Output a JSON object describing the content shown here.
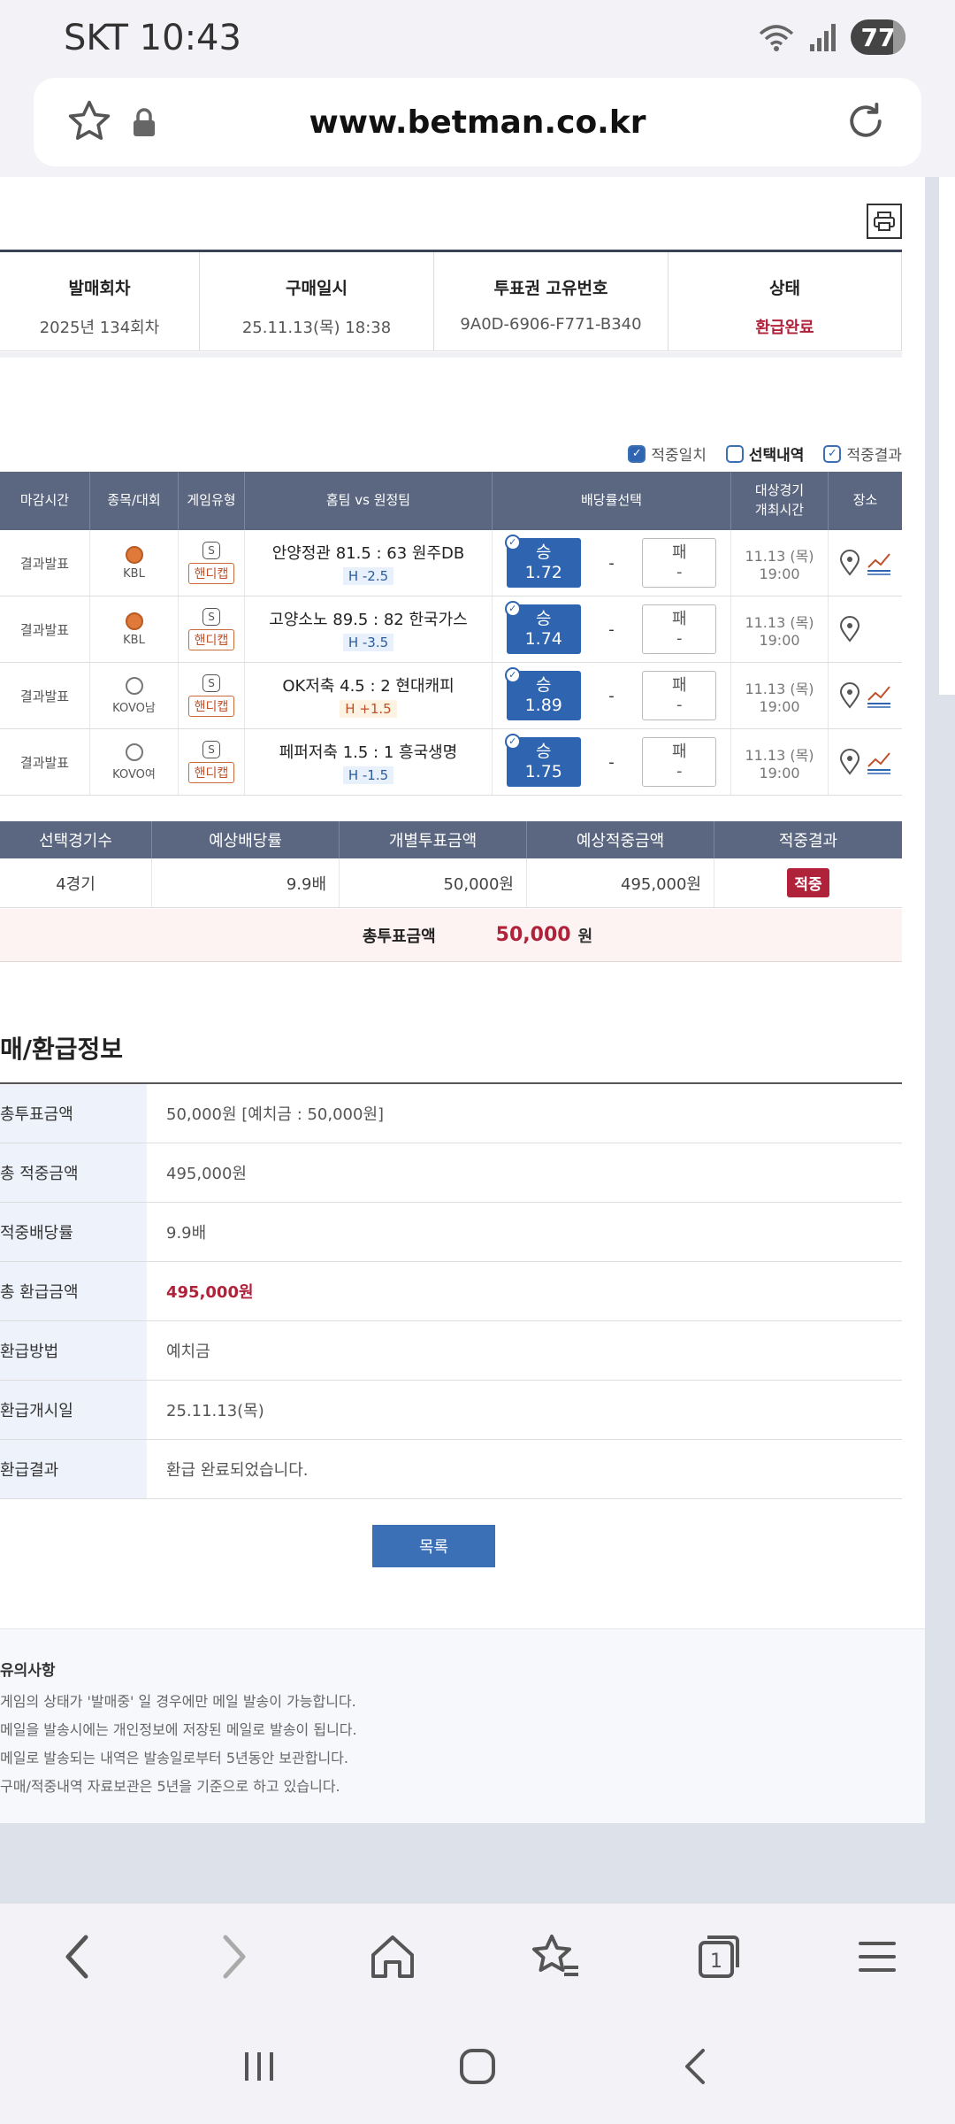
{
  "status": {
    "carrier_time": "SKT 10:43",
    "battery": "77"
  },
  "browser": {
    "url": "www.betman.co.kr"
  },
  "ticket_info": {
    "headers": [
      "발매회차",
      "구매일시",
      "투표권 고유번호",
      "상태"
    ],
    "values": [
      "2025년 134회차",
      "25.11.13(목) 18:38",
      "9A0D-6906-F771-B340",
      "환급완료"
    ]
  },
  "legend": {
    "hit_match": "적중일치",
    "selection": "선택내역",
    "hit_result": "적중결과"
  },
  "game_table": {
    "headers": [
      "마감시간",
      "종목/대회",
      "게임유형",
      "홈팀 vs 원정팀",
      "배당률선택",
      "대상경기\n개최시간",
      "장소"
    ],
    "rows": [
      {
        "close": "결과발표",
        "league": "KBL",
        "sport": "basketball",
        "type": "핸디캡",
        "match": "안양정관 81.5 : 63 원주DB",
        "handicap": "H -2.5",
        "win_label": "승",
        "win_odds": "1.72",
        "draw": "-",
        "lose_label": "패",
        "lose_odds": "-",
        "date": "11.13 (목)",
        "time": "19:00"
      },
      {
        "close": "결과발표",
        "league": "KBL",
        "sport": "basketball",
        "type": "핸디캡",
        "match": "고양소노 89.5 : 82 한국가스",
        "handicap": "H -3.5",
        "win_label": "승",
        "win_odds": "1.74",
        "draw": "-",
        "lose_label": "패",
        "lose_odds": "-",
        "date": "11.13 (목)",
        "time": "19:00"
      },
      {
        "close": "결과발표",
        "league": "KOVO남",
        "sport": "volleyball",
        "type": "핸디캡",
        "match": "OK저축 4.5 : 2 현대캐피",
        "handicap": "H +1.5",
        "win_label": "승",
        "win_odds": "1.89",
        "draw": "-",
        "lose_label": "패",
        "lose_odds": "-",
        "date": "11.13 (목)",
        "time": "19:00"
      },
      {
        "close": "결과발표",
        "league": "KOVO여",
        "sport": "volleyball",
        "type": "핸디캡",
        "match": "페퍼저축 1.5 : 1 흥국생명",
        "handicap": "H -1.5",
        "win_label": "승",
        "win_odds": "1.75",
        "draw": "-",
        "lose_label": "패",
        "lose_odds": "-",
        "date": "11.13 (목)",
        "time": "19:00"
      }
    ],
    "s_icon": "S"
  },
  "summary": {
    "headers": [
      "선택경기수",
      "예상배당률",
      "개별투표금액",
      "예상적중금액",
      "적중결과"
    ],
    "values": [
      "4경기",
      "9.9배",
      "50,000원",
      "495,000원"
    ],
    "result_badge": "적중",
    "total_label": "총투표금액",
    "total_amount": "50,000",
    "total_unit": "원"
  },
  "refund": {
    "title": "매/환급정보",
    "rows": [
      {
        "label": "총투표금액",
        "value": "50,000원 [예치금 : 50,000원]"
      },
      {
        "label": "총 적중금액",
        "value": "495,000원"
      },
      {
        "label": "적중배당률",
        "value": "9.9배"
      },
      {
        "label": "총 환급금액",
        "value": "495,000원"
      },
      {
        "label": "환급방법",
        "value": "예치금"
      },
      {
        "label": "환급개시일",
        "value": "25.11.13(목)"
      },
      {
        "label": "환급결과",
        "value": "환급 완료되었습니다."
      }
    ],
    "list_button": "목록"
  },
  "notice": {
    "title": "유의사항",
    "items": [
      "게임의 상태가 '발매중' 일 경우에만 메일 발송이 가능합니다.",
      "메일을 발송시에는 개인정보에 저장된 메일로 발송이 됩니다.",
      "메일로 발송되는 내역은 발송일로부터 5년동안 보관합니다.",
      "구매/적중내역 자료보관은 5년을 기준으로 하고 있습니다."
    ]
  },
  "colors": {
    "header": "#5b6780",
    "accent_blue": "#2e64b0",
    "accent_red": "#b0213a"
  }
}
